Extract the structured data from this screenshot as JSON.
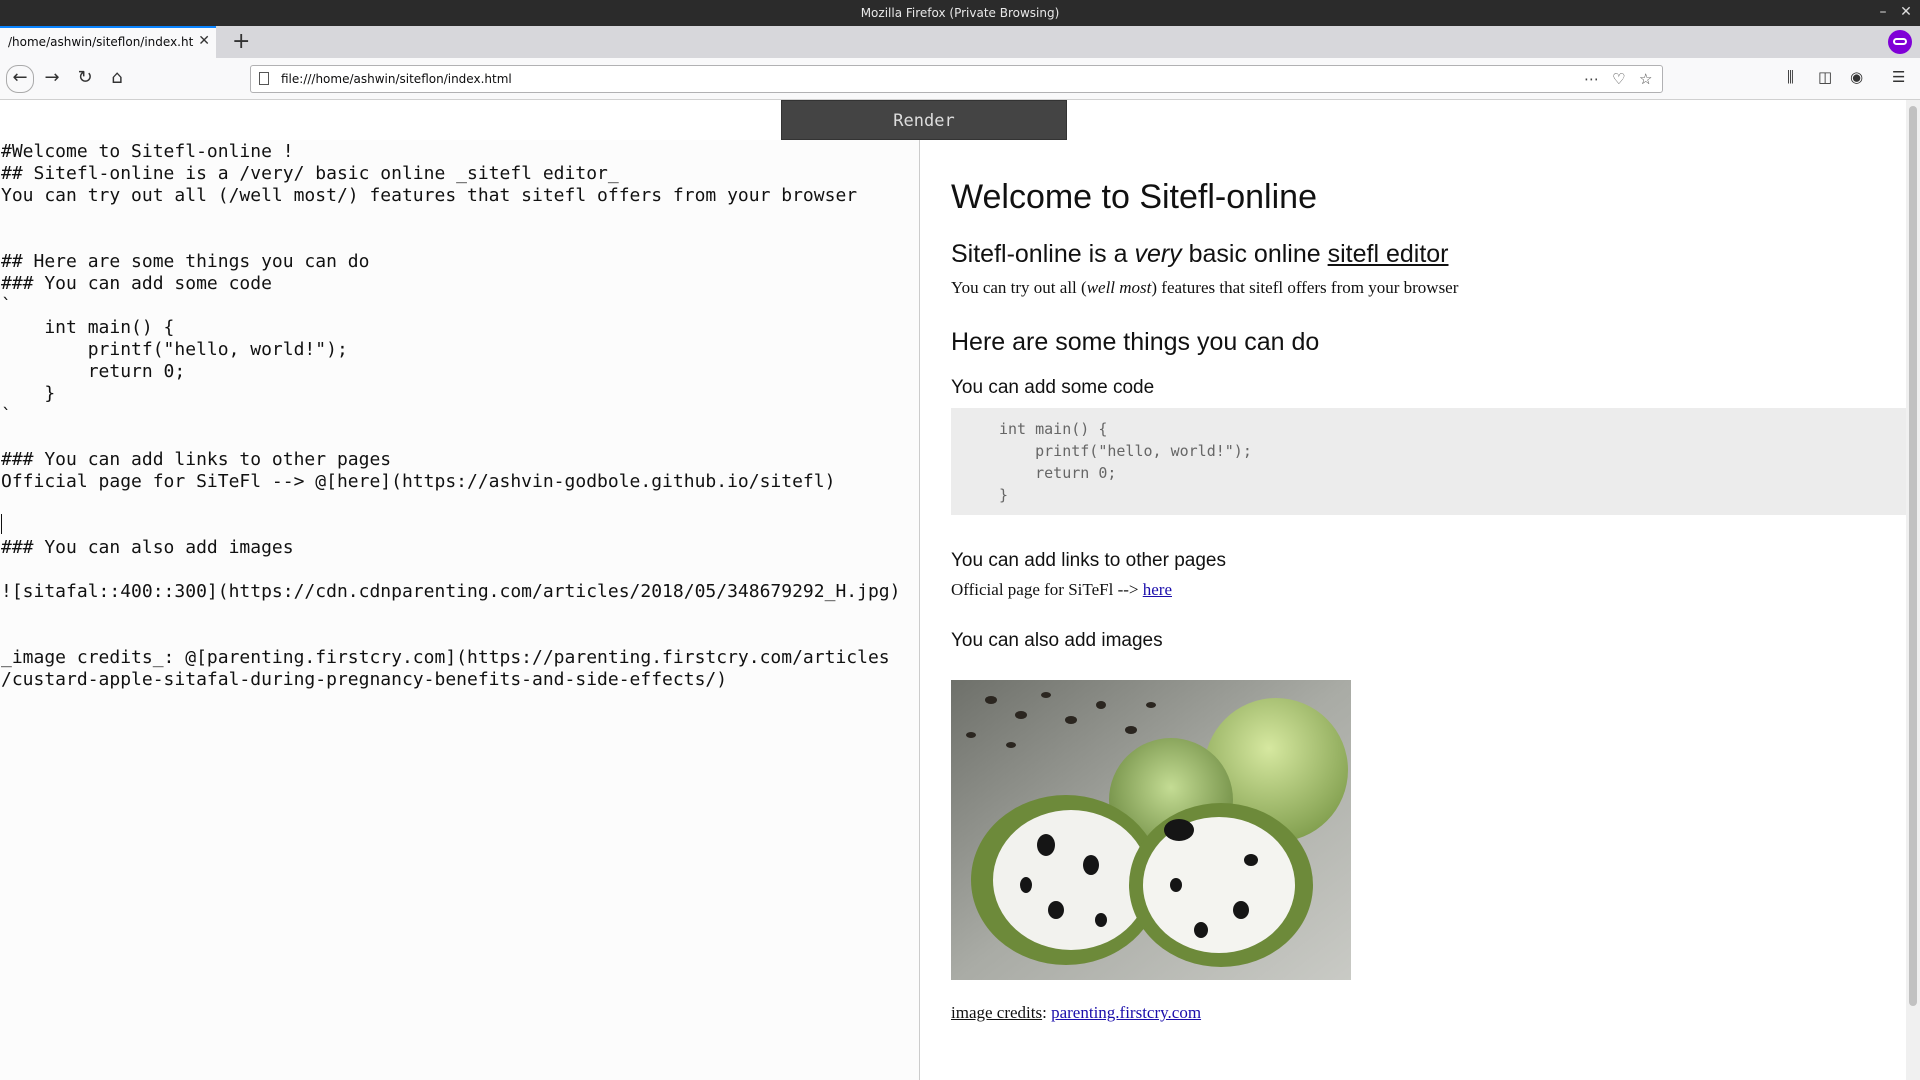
{
  "window": {
    "title": "Mozilla Firefox (Private Browsing)"
  },
  "tab": {
    "label": "/home/ashwin/siteflon/index.html"
  },
  "urlbar": {
    "url": "file:///home/ashwin/siteflon/index.html"
  },
  "render_button": {
    "label": "Render"
  },
  "editor": {
    "text": "#Welcome to Sitefl-online !\n## Sitefl-online is a /very/ basic online _sitefl editor_\nYou can try out all (/well most/) features that sitefl offers from your browser\n\n\n## Here are some things you can do\n### You can add some code\n`\n    int main() {\n        printf(\"hello, world!\");\n        return 0;\n    }\n`\n\n### You can add links to other pages\nOfficial page for SiTeFl --> @[here](https://ashvin-godbole.github.io/sitefl)\n\n\n### You can also add images\n\n![sitafal::400::300](https://cdn.cdnparenting.com/articles/2018/05/348679292_H.jpg)\n\n\n_image credits_: @[parenting.firstcry.com](https://parenting.firstcry.com/articles\n/custard-apple-sitafal-during-pregnancy-benefits-and-side-effects/)"
  },
  "preview": {
    "h1": "Welcome to Sitefl-online",
    "h2_prefix": "Sitefl-online is a",
    "h2_italic": "very",
    "h2_mid": "basic online",
    "h2_underline": "sitefl editor",
    "p1_a": "You can try out all (",
    "p1_italic": "well most",
    "p1_b": ") features that sitefl offers from your browser",
    "h2b": "Here are some things you can do",
    "h3_code": "You can add some code",
    "code": "int main() {\n    printf(\"hello, world!\");\n    return 0;\n}",
    "h3_links": "You can add links to other pages",
    "link_prefix": "Official page for SiTeFl -->",
    "link_text": "here",
    "h3_images": "You can also add images",
    "credits_label": "image credits",
    "credits_colon": ":",
    "credits_link": "parenting.firstcry.com"
  },
  "colors": {
    "accent": "#0a84ff",
    "private": "#8000d7",
    "render_button": "#444444"
  }
}
